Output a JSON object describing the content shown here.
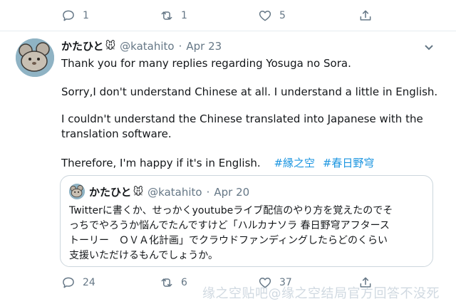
{
  "previous_tweet": {
    "reply_count": "1",
    "retweet_count": "1",
    "like_count": "5"
  },
  "tweet": {
    "name": "かたひと",
    "name_emoji": "🐭",
    "handle": "@katahito",
    "separator": "·",
    "date": "Apr 23",
    "lines": [
      "Thank you for many replies regarding Yosuga no Sora.",
      "Sorry,I don't understand Chinese at all. I understand a little in English.",
      "I couldn't understand the Chinese translated into Japanese with the",
      "translation software.",
      "Therefore, I'm happy if it's in English."
    ],
    "hashtags": [
      "#縁之空",
      "#春日野穹"
    ],
    "reply_count": "24",
    "retweet_count": "6",
    "like_count": "37"
  },
  "quoted_tweet": {
    "name": "かたひと",
    "name_emoji": "🐭",
    "handle": "@katahito",
    "separator": "·",
    "date": "Apr 20",
    "lines": [
      "Twitterに書くか、せっかくyoutubeライブ配信のやり方を覚えたのでそ",
      "っちでやろうか悩んでたんですけど「ハルカナソラ 春日野穹アフタース",
      "トーリー　ＯＶＡ化計画」でクラウドファンディングしたらどのくらい",
      "支援いただけるもんでしょうか。"
    ]
  },
  "watermark": "缘之空贴吧@缘之空结局官方回答不没死",
  "icons": {
    "reply": "reply-icon",
    "retweet": "retweet-icon",
    "like": "heart-icon",
    "share": "share-icon",
    "menu": "chevron-down-icon"
  },
  "colors": {
    "text": "#14171a",
    "secondary": "#657786",
    "hashtag": "#1b95e0",
    "border": "#ccd6dd"
  }
}
